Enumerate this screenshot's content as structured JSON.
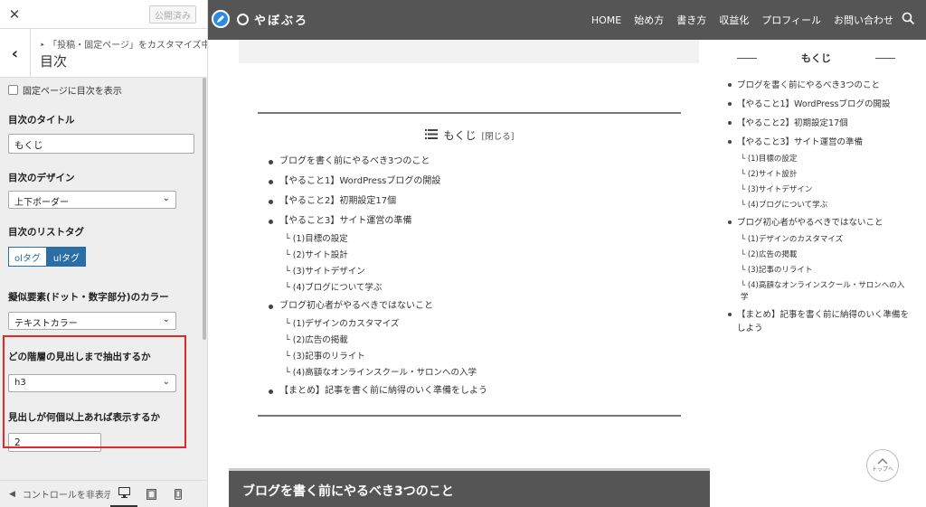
{
  "customizer": {
    "publish_label": "公開済み",
    "breadcrumb": "「投稿・固定ページ」をカスタマイズ中",
    "breadcrumb_prefix": "‣",
    "section_title": "目次",
    "show_on_pages_label": "固定ページに目次を表示",
    "title_label": "目次のタイトル",
    "title_value": "もくじ",
    "design_label": "目次のデザイン",
    "design_value": "上下ボーダー",
    "list_tag_label": "目次のリストタグ",
    "list_tag_options": [
      "olタグ",
      "ulタグ"
    ],
    "list_tag_selected": "ulタグ",
    "pseudo_color_label": "擬似要素(ドット・数字部分)のカラー",
    "pseudo_color_value": "テキストカラー",
    "depth_label": "どの階層の見出しまで抽出するか",
    "depth_value": "h3",
    "min_count_label": "見出しが何個以上あれば表示するか",
    "min_count_value": "2",
    "hide_controls_label": "コントロールを非表示",
    "highlight_color": "#e02a2a",
    "accent_color": "#2a6ea8"
  },
  "site": {
    "logo_text": "やぼぶろ",
    "nav": [
      "HOME",
      "始め方",
      "書き方",
      "収益化",
      "プロフィール",
      "お問い合わせ"
    ],
    "header_color": "#555555"
  },
  "toc": {
    "title": "もくじ",
    "close_label": "[閉じる]",
    "items": [
      {
        "label": "ブログを書く前にやるべき3つのこと",
        "children": []
      },
      {
        "label": "【やること1】WordPressブログの開設",
        "children": []
      },
      {
        "label": "【やること2】初期設定17個",
        "children": []
      },
      {
        "label": "【やること3】サイト運営の準備",
        "children": [
          "└ (1)目標の設定",
          "└ (2)サイト設計",
          "└ (3)サイトデザイン",
          "└ (4)ブログについて学ぶ"
        ]
      },
      {
        "label": "ブログ初心者がやるべきではないこと",
        "children": [
          "└ (1)デザインのカスタマイズ",
          "└ (2)広告の掲載",
          "└ (3)記事のリライト",
          "└ (4)高額なオンラインスクール・サロンへの入学"
        ]
      },
      {
        "label": "【まとめ】記事を書く前に納得のいく準備をしよう",
        "children": []
      }
    ]
  },
  "section_heading": "ブログを書く前にやるべき3つのこと",
  "sidebar_toc": {
    "title": "もくじ",
    "items": [
      {
        "label": "ブログを書く前にやるべき3つのこと",
        "children": []
      },
      {
        "label": "【やること1】WordPressブログの開設",
        "children": []
      },
      {
        "label": "【やること2】初期設定17個",
        "children": []
      },
      {
        "label": "【やること3】サイト運営の準備",
        "children": [
          "└ (1)目標の設定",
          "└ (2)サイト設計",
          "└ (3)サイトデザイン",
          "└ (4)ブログについて学ぶ"
        ]
      },
      {
        "label": "ブログ初心者がやるべきではないこと",
        "children": [
          "└ (1)デザインのカスタマイズ",
          "└ (2)広告の掲載",
          "└ (3)記事のリライト",
          "└ (4)高額なオンラインスクール・サロンへの入学"
        ]
      },
      {
        "label": "【まとめ】記事を書く前に納得のいく準備をしよう",
        "children": []
      }
    ]
  },
  "to_top_label": "トップへ"
}
